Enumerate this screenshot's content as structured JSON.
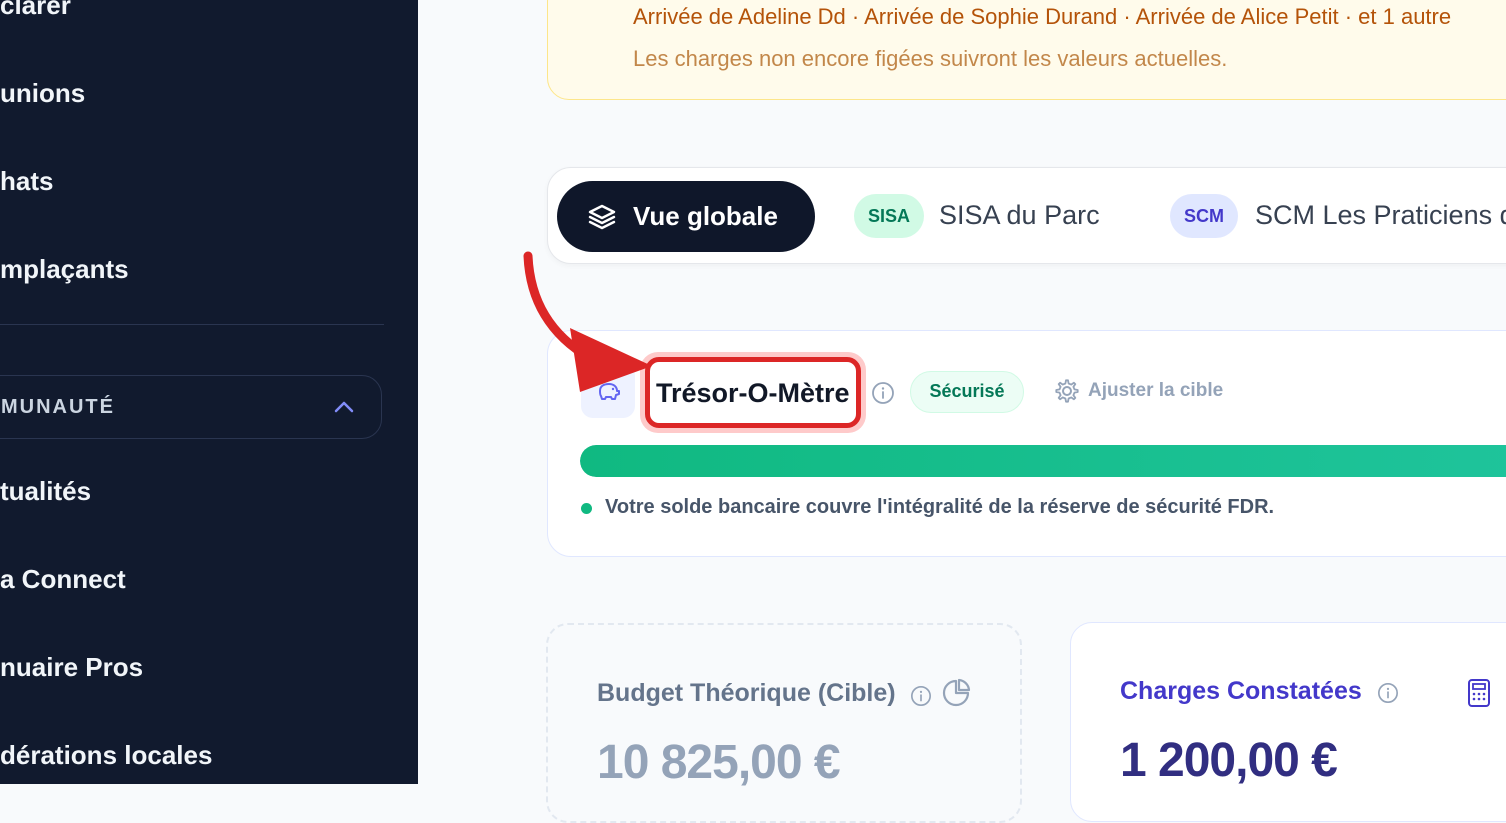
{
  "sidebar": {
    "items_top": [
      "clarer",
      "unions",
      "hats",
      "mplaçants"
    ],
    "section": {
      "label": "MUNAUTÉ"
    },
    "items_bottom": [
      "tualités",
      "a Connect",
      "nuaire Pros",
      "dérations locales"
    ]
  },
  "notice": {
    "line1": "Arrivée de Adeline Dd · Arrivée de Sophie Durand · Arrivée de Alice Petit · et 1 autre",
    "line2": "Les charges non encore figées suivront les valeurs actuelles."
  },
  "tabs": {
    "active": "Vue globale",
    "items": [
      {
        "pill": "SISA",
        "label": "SISA du Parc",
        "pill_bg": "#d1fae5",
        "pill_color": "#047857"
      },
      {
        "pill": "SCM",
        "label": "SCM Les Praticiens d",
        "pill_bg": "#e0e7ff",
        "pill_color": "#4338ca"
      }
    ]
  },
  "tresor": {
    "title": "Trésor-O-Mètre",
    "badge": "Sécurisé",
    "adjust_label": "Ajuster la cible",
    "progress": 1.0,
    "status_text": "Votre solde bancaire couvre l'intégralité de la réserve de sécurité FDR."
  },
  "budget": {
    "title": "Budget Théorique (Cible)",
    "value": "10 825,00 €"
  },
  "charges": {
    "title": "Charges Constatées",
    "value": "1 200,00 €"
  },
  "colors": {
    "sidebar_bg": "#111a2e",
    "accent_green": "#10b981",
    "accent_indigo": "#4338ca",
    "highlight_red": "#dc2626"
  }
}
